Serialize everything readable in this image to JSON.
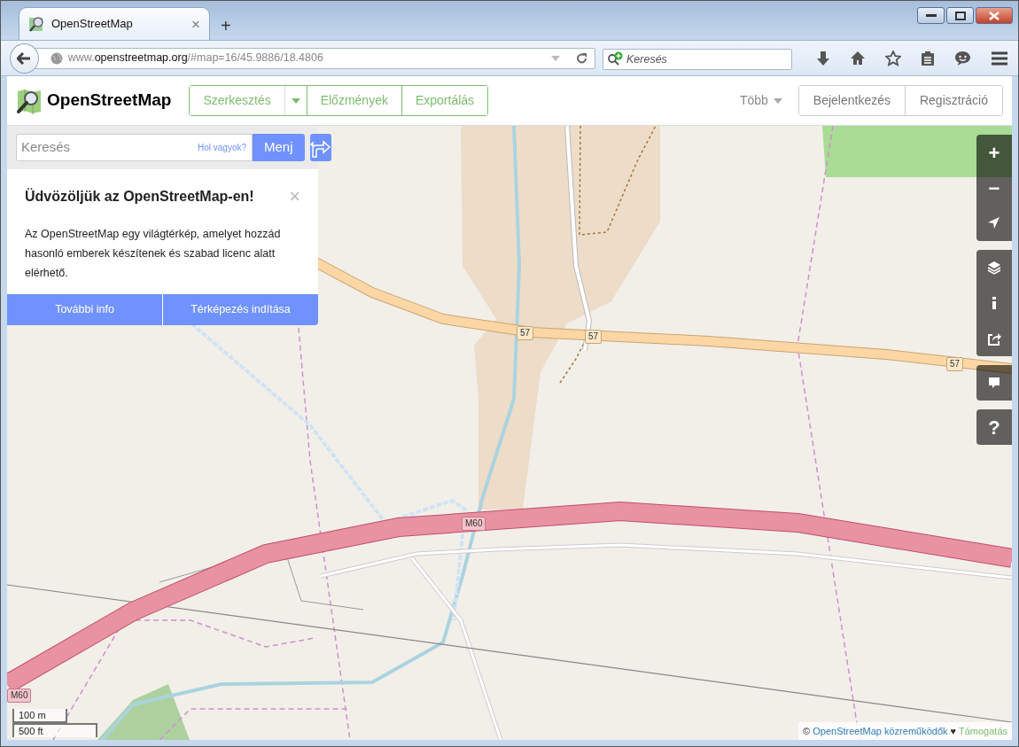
{
  "browser": {
    "tab_title": "OpenStreetMap",
    "tab_close": "×",
    "new_tab": "+",
    "url": {
      "prefix": "www.",
      "domain": "openstreetmap.org",
      "path": "/#map=16/45.9886/18.4806"
    },
    "search_placeholder": "Keresés"
  },
  "header": {
    "logo_text": "OpenStreetMap",
    "nav_buttons": [
      {
        "label": "Szerkesztés",
        "kind": "text"
      },
      {
        "kind": "caret"
      },
      {
        "label": "Előzmények",
        "kind": "text"
      },
      {
        "label": "Exportálás",
        "kind": "text"
      }
    ],
    "more": "Több",
    "account_buttons": [
      "Bejelentkezés",
      "Regisztráció"
    ]
  },
  "search": {
    "placeholder": "Keresés",
    "where_link": "Hol vagyok?",
    "go_button": "Menj"
  },
  "welcome": {
    "title": "Üdvözöljük az OpenStreetMap-en!",
    "close": "×",
    "text": "Az OpenStreetMap egy világtérkép, amelyet hozzád hasonló emberek készítenek és szabad licenc alatt elérhető.",
    "buttons": [
      "További info",
      "Térképezés indítása"
    ]
  },
  "map_controls": [
    [
      {
        "kind": "zoom-in",
        "glyph": "+"
      },
      {
        "kind": "zoom-out",
        "glyph": "−"
      },
      {
        "kind": "locate"
      }
    ],
    [
      {
        "kind": "layers"
      },
      {
        "kind": "info"
      },
      {
        "kind": "share"
      }
    ],
    [
      {
        "kind": "note"
      }
    ],
    [
      {
        "kind": "help",
        "glyph": "?"
      }
    ]
  ],
  "road_shields": [
    "57",
    "57",
    "57",
    "M60",
    "M60"
  ],
  "scale": [
    "100 m",
    "500 ft"
  ],
  "attribution": {
    "symbol": "©",
    "link": "OpenStreetMap közreműködők",
    "heart": "♥",
    "support": "Támogatás"
  }
}
